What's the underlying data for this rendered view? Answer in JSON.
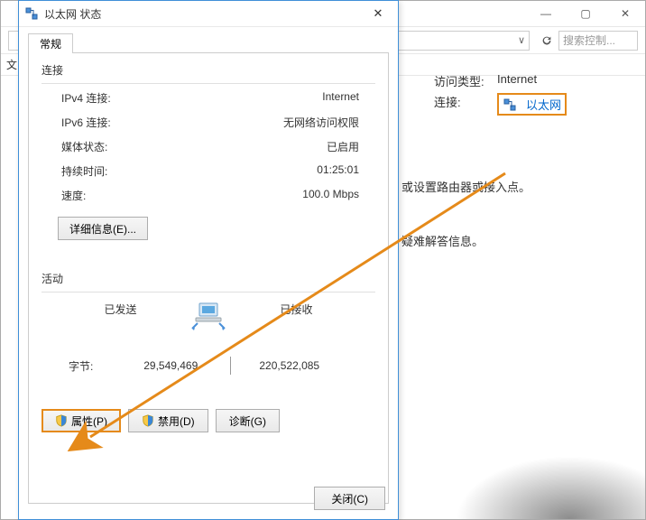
{
  "bg": {
    "addr_chevron": "∨",
    "search_placeholder": "搜索控制...",
    "menu_file": "文",
    "access_type_label": "访问类型:",
    "access_type_value": "Internet",
    "connection_label": "连接:",
    "ethernet_link": "以太网",
    "msg1": "或设置路由器或接入点。",
    "msg2": "疑难解答信息。"
  },
  "dialog": {
    "title": "以太网 状态",
    "tab_general": "常规",
    "connection_title": "连接",
    "rows": {
      "ipv4_label": "IPv4 连接:",
      "ipv4_value": "Internet",
      "ipv6_label": "IPv6 连接:",
      "ipv6_value": "无网络访问权限",
      "media_label": "媒体状态:",
      "media_value": "已启用",
      "duration_label": "持续时间:",
      "duration_value": "01:25:01",
      "speed_label": "速度:",
      "speed_value": "100.0 Mbps"
    },
    "details_button": "详细信息(E)...",
    "activity_title": "活动",
    "sent_label": "已发送",
    "recv_label": "已接收",
    "bytes_label": "字节:",
    "sent_value": "29,549,469",
    "recv_value": "220,522,085",
    "properties_button": "属性(P)",
    "disable_button": "禁用(D)",
    "diagnose_button": "诊断(G)",
    "close_button": "关闭(C)"
  }
}
